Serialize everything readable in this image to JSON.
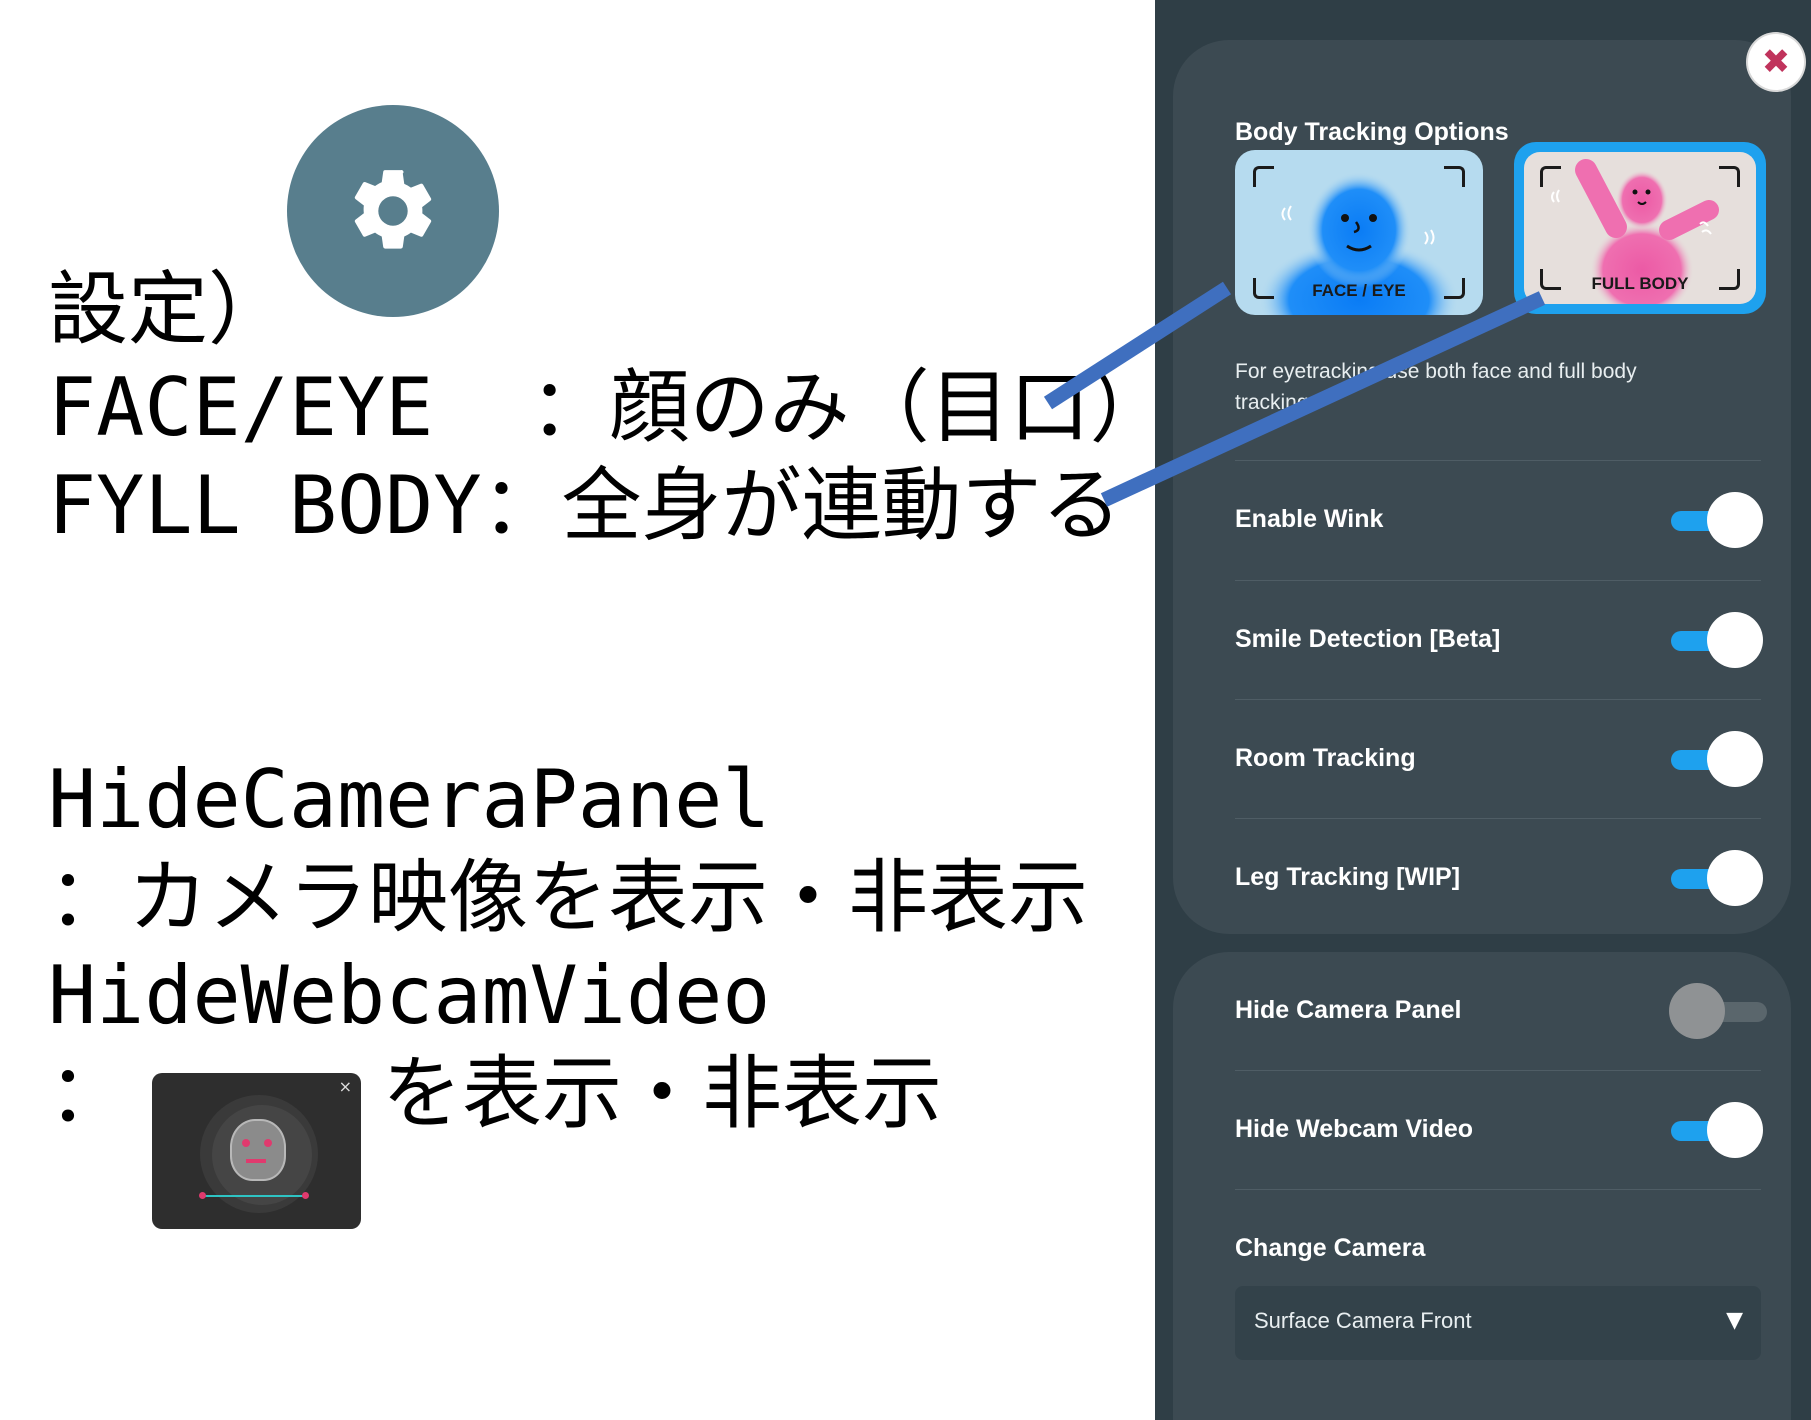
{
  "annotation": {
    "line1": "設定）",
    "line2": "FACE/EYE  ：顔のみ（目口）",
    "line3": "FYLL BODY：全身が連動する",
    "line4": "HideCameraPanel",
    "line5": "：カメラ映像を表示・非表示",
    "line6": "HideWebcamVideo",
    "line7_prefix": "：",
    "line7_suffix": "を表示・非表示"
  },
  "icons": {
    "settings": "gear-icon",
    "close": "close-icon",
    "dropdown": "caret-down-icon"
  },
  "colors": {
    "panel_bg": "#2f3e46",
    "card_bg": "#3c4a52",
    "accent": "#1ea1ee",
    "close_x": "#c0335c",
    "annotation_arrow": "#3f6fbf"
  },
  "settings_panel": {
    "close_symbol": "✖",
    "body_tracking": {
      "title": "Body Tracking Options",
      "options": [
        {
          "label": "FACE / EYE",
          "selected": false
        },
        {
          "label": "FULL BODY",
          "selected": true
        }
      ],
      "description": "For eyetracking use both face and full body tracking"
    },
    "toggles": [
      {
        "label": "Enable Wink",
        "on": true
      },
      {
        "label": "Smile Detection [Beta]",
        "on": true
      },
      {
        "label": "Room Tracking",
        "on": true
      },
      {
        "label": "Leg Tracking [WIP]",
        "on": true
      }
    ],
    "camera": {
      "hide_camera_panel": {
        "label": "Hide Camera Panel",
        "on": false
      },
      "hide_webcam_video": {
        "label": "Hide Webcam Video",
        "on": true
      },
      "change_camera_label": "Change Camera",
      "selected_camera": "Surface Camera Front",
      "caret": "▼"
    }
  },
  "mini_preview": {
    "close_symbol": "×"
  }
}
